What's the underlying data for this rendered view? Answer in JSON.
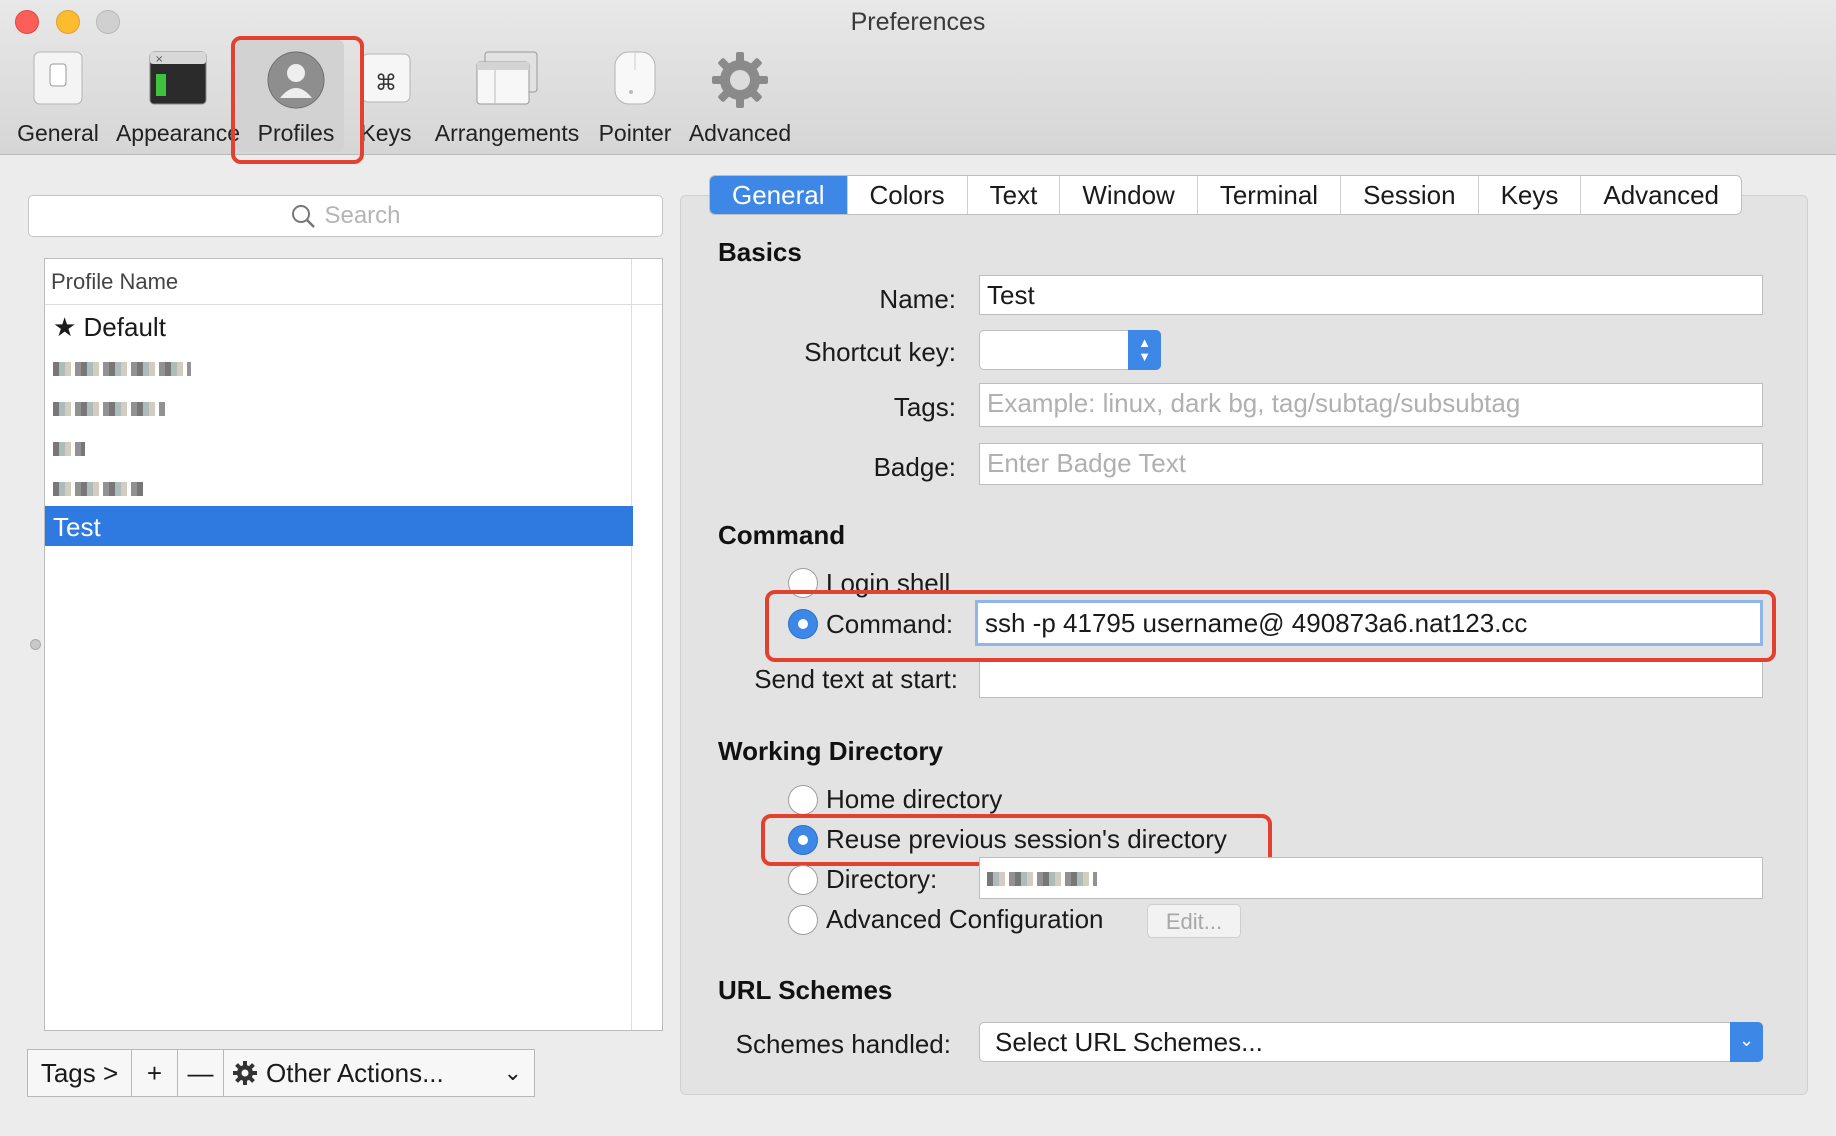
{
  "window": {
    "title": "Preferences"
  },
  "toolbar": {
    "items": [
      {
        "label": "General",
        "icon": "switch-icon"
      },
      {
        "label": "Appearance",
        "icon": "terminal-window-icon"
      },
      {
        "label": "Profiles",
        "icon": "user-icon"
      },
      {
        "label": "Keys",
        "icon": "command-key-icon"
      },
      {
        "label": "Arrangements",
        "icon": "windows-icon"
      },
      {
        "label": "Pointer",
        "icon": "mouse-icon"
      },
      {
        "label": "Advanced",
        "icon": "gear-icon"
      }
    ],
    "selected": "Profiles"
  },
  "sidebar": {
    "search_placeholder": "Search",
    "column_header": "Profile Name",
    "profiles": [
      {
        "name": "★ Default"
      },
      {
        "name": "",
        "redacted": true
      },
      {
        "name": "",
        "redacted": true
      },
      {
        "name": "",
        "redacted": true
      },
      {
        "name": "",
        "redacted": true
      },
      {
        "name": "Test",
        "selected": true
      }
    ],
    "bottom_bar": {
      "tags_label": "Tags >",
      "add_label": "+",
      "remove_label": "—",
      "other_actions_label": "Other Actions...",
      "chevron": "⌄"
    }
  },
  "tabs": [
    "General",
    "Colors",
    "Text",
    "Window",
    "Terminal",
    "Session",
    "Keys",
    "Advanced"
  ],
  "active_tab": "General",
  "basics": {
    "heading": "Basics",
    "name_label": "Name:",
    "name_value": "Test",
    "shortcut_label": "Shortcut key:",
    "tags_label": "Tags:",
    "tags_placeholder": "Example: linux, dark bg, tag/subtag/subsubtag",
    "badge_label": "Badge:",
    "badge_placeholder": "Enter Badge Text"
  },
  "command": {
    "heading": "Command",
    "login_shell_label": "Login shell",
    "command_label": "Command:",
    "command_value": "ssh -p 41795 username@    490873a6.nat123.cc",
    "send_text_label": "Send text at start:",
    "send_text_value": "",
    "selected": "Command"
  },
  "working_directory": {
    "heading": "Working Directory",
    "home_label": "Home directory",
    "reuse_label": "Reuse previous session's directory",
    "directory_label": "Directory:",
    "advanced_label": "Advanced Configuration",
    "edit_label": "Edit...",
    "selected": "Reuse previous session's directory"
  },
  "url_schemes": {
    "heading": "URL Schemes",
    "schemes_label": "Schemes handled:",
    "select_value": "Select URL Schemes..."
  },
  "colors": {
    "accent": "#3d87e6",
    "highlight": "#e3402f",
    "selection": "#2f7ae0"
  }
}
